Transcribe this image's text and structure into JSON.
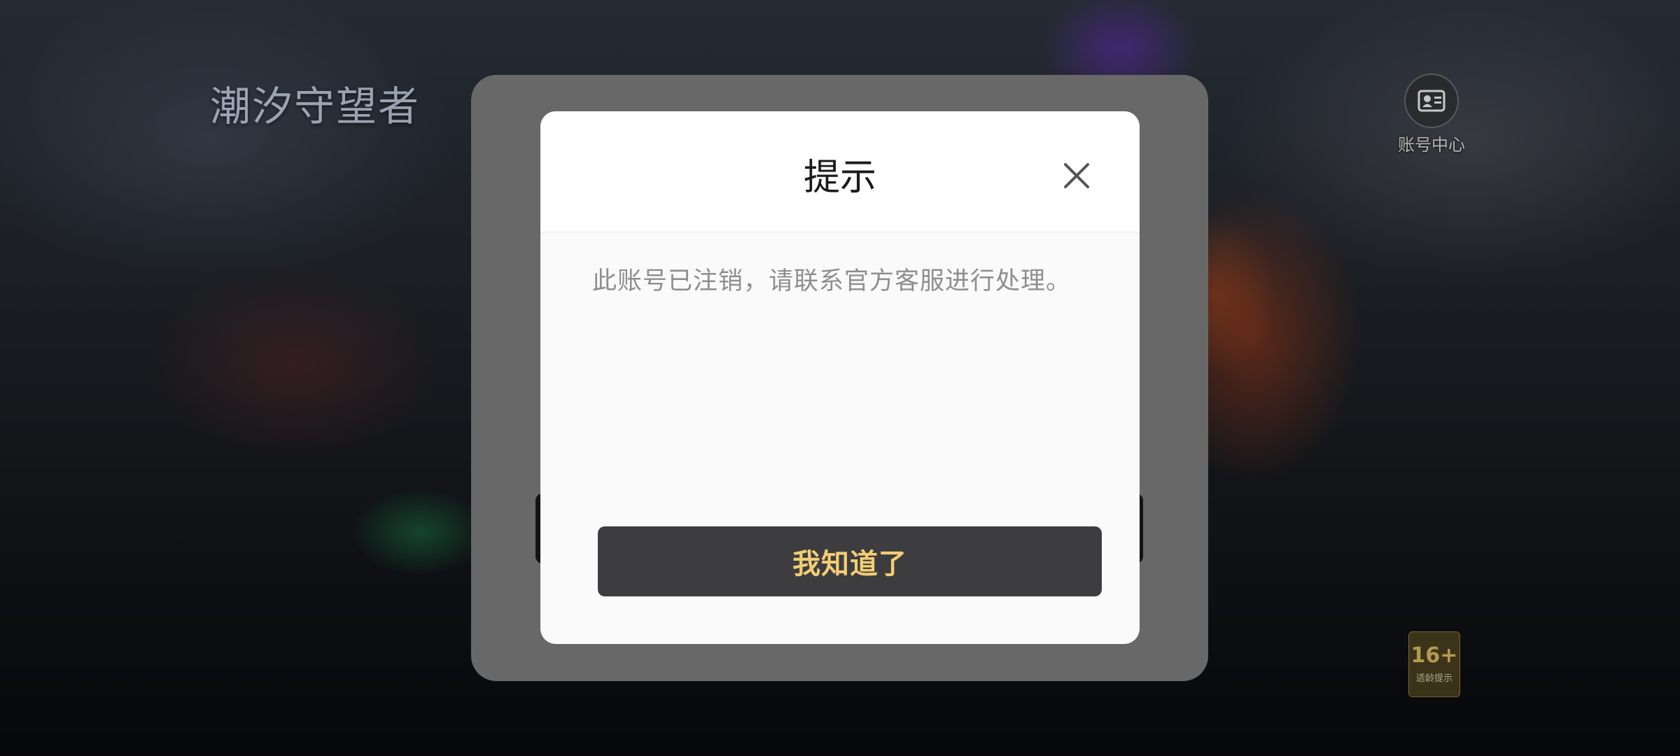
{
  "game": {
    "logo_text": "潮汐守望者",
    "account_center_label": "账号中心",
    "age_rating": {
      "number": "16+",
      "label": "适龄提示"
    }
  },
  "dialog": {
    "title": "提示",
    "message": "此账号已注销，请联系官方客服进行处理。",
    "confirm_label": "我知道了",
    "close_icon": "close-icon"
  },
  "colors": {
    "confirm_bg": "#3d3d40",
    "confirm_text": "#f2cd74",
    "panel_overlay": "#686868"
  }
}
